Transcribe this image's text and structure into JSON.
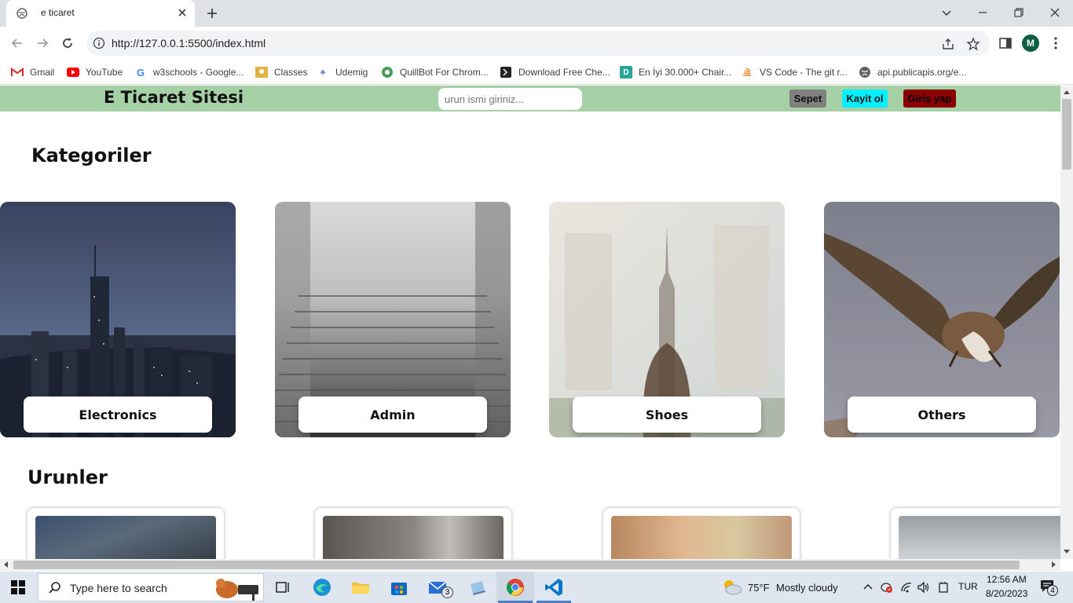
{
  "browser": {
    "tab_title": "e ticaret",
    "url": "http://127.0.0.1:5500/index.html",
    "profile_initial": "M",
    "bookmarks": [
      {
        "label": "Gmail",
        "icon": "gmail-icon"
      },
      {
        "label": "YouTube",
        "icon": "youtube-icon"
      },
      {
        "label": "w3schools - Google...",
        "icon": "google-icon"
      },
      {
        "label": "Classes",
        "icon": "classes-icon"
      },
      {
        "label": "Udemig",
        "icon": "udemig-icon"
      },
      {
        "label": "QuillBot For Chrom...",
        "icon": "quillbot-icon"
      },
      {
        "label": "Download Free Che...",
        "icon": "download-icon"
      },
      {
        "label": "En İyi 30.000+ Chair...",
        "icon": "chair-icon"
      },
      {
        "label": "VS Code - The git r...",
        "icon": "stackoverflow-icon"
      },
      {
        "label": "api.publicapis.org/e...",
        "icon": "globe-icon"
      }
    ]
  },
  "page": {
    "site_title": "E Ticaret Sitesi",
    "search_placeholder": "urun ismi giriniz...",
    "nav_buttons": {
      "sepet": "Sepet",
      "kayit": "Kayit ol",
      "giris": "Giriş yap"
    },
    "categories_heading": "Kategoriler",
    "categories": [
      {
        "label": "Electronics",
        "image": "city-skyline-night"
      },
      {
        "label": "Admin",
        "image": "misty-staircase"
      },
      {
        "label": "Shoes",
        "image": "woman-city-double-exposure"
      },
      {
        "label": "Others",
        "image": "vulture-flying"
      }
    ],
    "products_heading": "Urunler",
    "products": [
      {
        "image": "rocky-landscape"
      },
      {
        "image": "stone-building"
      },
      {
        "image": "blurred-street"
      },
      {
        "image": "foggy-scene"
      }
    ]
  },
  "taskbar": {
    "search_text": "Type here to search",
    "mail_badge": "3",
    "weather_temp": "75°F",
    "weather_text": "Mostly cloudy",
    "language": "TUR",
    "time": "12:56 AM",
    "date": "8/20/2023",
    "notification_count": "4"
  },
  "colors": {
    "nav_bg": "#a6d1a6",
    "sepet_bg": "#808080",
    "kayit_bg": "#00f0ff",
    "giris_bg": "#8b0000"
  }
}
